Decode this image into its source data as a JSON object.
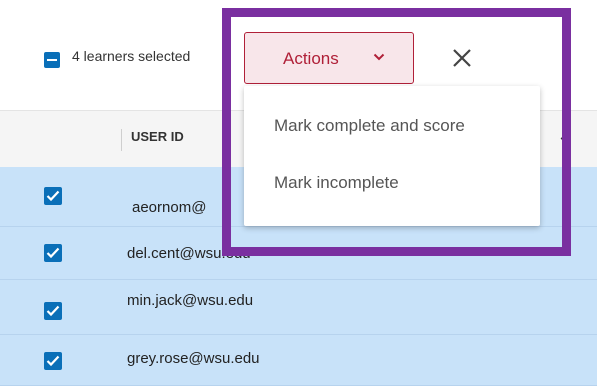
{
  "selection": {
    "label": "4 learners selected"
  },
  "actions": {
    "label": "Actions"
  },
  "menu": {
    "items": [
      {
        "label": "Mark complete and score"
      },
      {
        "label": "Mark incomplete"
      }
    ]
  },
  "table": {
    "headers": [
      {
        "label": "USER ID"
      }
    ],
    "rows": [
      {
        "user_id": "aeornom@"
      },
      {
        "user_id": "del.cent@wsu.edu"
      },
      {
        "user_id": "min.jack@wsu.edu"
      },
      {
        "user_id": "grey.rose@wsu.edu"
      }
    ]
  },
  "colors": {
    "accent": "#b02038",
    "checkbox": "#0a6fb8",
    "highlight": "#7a2fa0",
    "row_selected": "#c8e2f9"
  },
  "icons": {
    "close": "close-icon",
    "dropdown": "chevron-down-icon",
    "sort": "sort-icon",
    "checkbox": "checkbox-checked-icon"
  }
}
